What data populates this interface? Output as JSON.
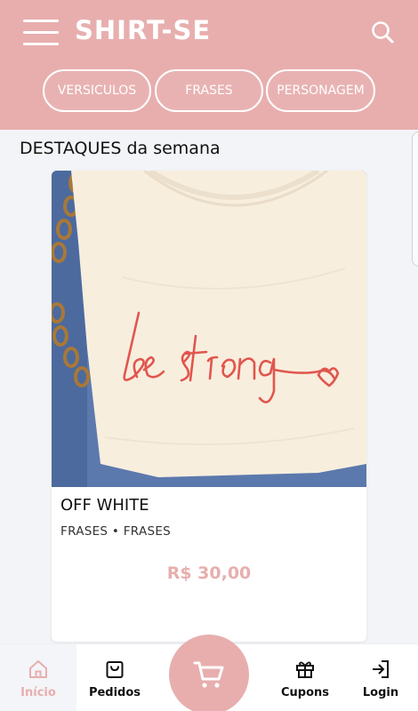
{
  "header": {
    "brand": "SHIRT-SE",
    "tabs": [
      {
        "label": "VERSICULOS"
      },
      {
        "label": "FRASES"
      },
      {
        "label": "PERSONAGEM"
      }
    ]
  },
  "highlights": {
    "title": "DESTAQUES da semana",
    "product": {
      "name": "OFF WHITE",
      "category": "FRASES • FRASES",
      "price": "R$ 30,00",
      "print_text": "be strong"
    }
  },
  "bottom_nav": {
    "items": [
      {
        "label": "Início",
        "icon": "home-icon",
        "active": true
      },
      {
        "label": "Pedidos",
        "icon": "bag-icon"
      },
      {
        "label": "Cupons",
        "icon": "gift-icon"
      },
      {
        "label": "Login",
        "icon": "login-icon"
      }
    ],
    "cart_icon": "cart-icon"
  },
  "colors": {
    "accent": "#e8aeae",
    "background": "#f3f4f7",
    "print": "#e0564e"
  }
}
